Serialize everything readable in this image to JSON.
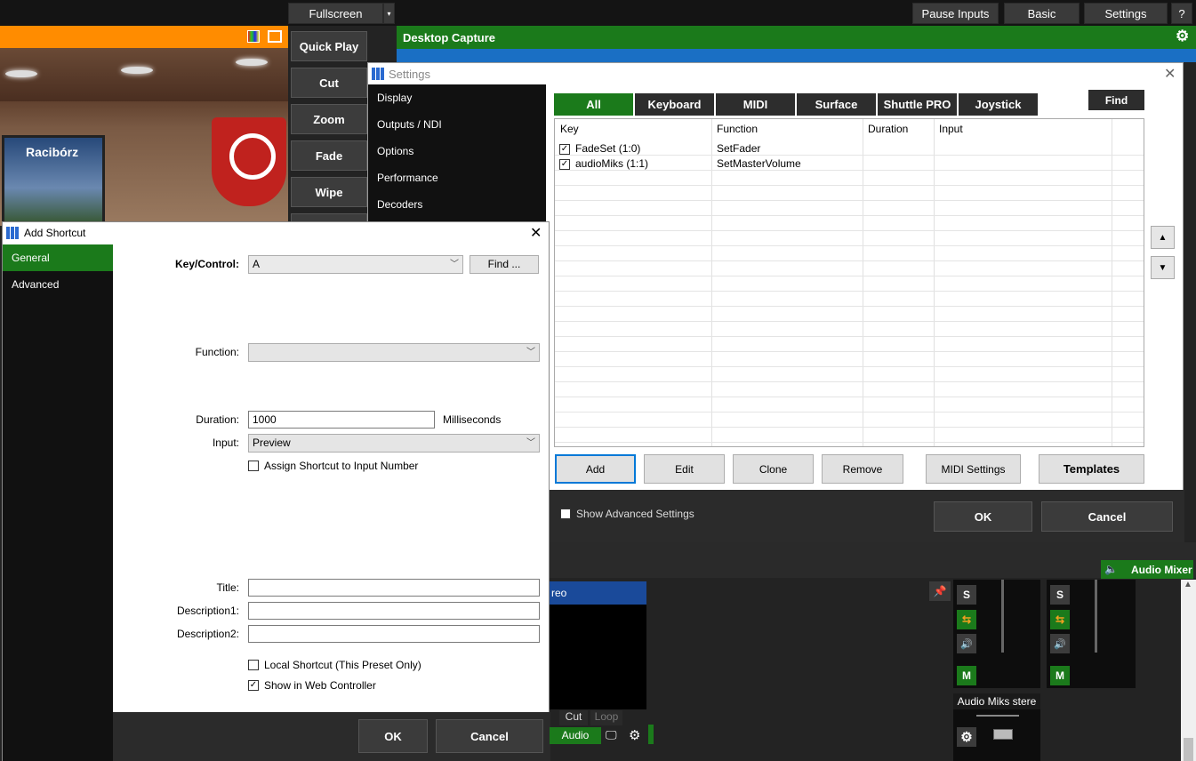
{
  "topbar": {
    "fullscreen": "Fullscreen",
    "pause_inputs": "Pause Inputs",
    "basic": "Basic",
    "settings": "Settings",
    "help": "?"
  },
  "preview": {
    "banner_text": "Racibórz"
  },
  "transitions": {
    "quick_play": "Quick Play",
    "cut": "Cut",
    "zoom": "Zoom",
    "fade": "Fade",
    "wipe": "Wipe"
  },
  "input_panel": {
    "title": "Desktop Capture"
  },
  "settings_dialog": {
    "title": "Settings",
    "nav": [
      "Display",
      "Outputs / NDI",
      "Options",
      "Performance",
      "Decoders"
    ],
    "tabs": [
      "All",
      "Keyboard",
      "MIDI",
      "Surface",
      "Shuttle PRO",
      "Joystick"
    ],
    "find": "Find",
    "columns": [
      "Key",
      "Function",
      "Duration",
      "Input"
    ],
    "rows": [
      {
        "checked": true,
        "key": "FadeSet (1:0)",
        "function": "SetFader",
        "duration": "",
        "input": ""
      },
      {
        "checked": true,
        "key": "audioMiks (1:1)",
        "function": "SetMasterVolume",
        "duration": "",
        "input": ""
      }
    ],
    "buttons": {
      "add": "Add",
      "edit": "Edit",
      "clone": "Clone",
      "remove": "Remove",
      "midi_settings": "MIDI Settings",
      "templates": "Templates"
    },
    "show_advanced": "Show Advanced Settings",
    "ok": "OK",
    "cancel": "Cancel"
  },
  "add_shortcut": {
    "title": "Add Shortcut",
    "nav": [
      "General",
      "Advanced"
    ],
    "key_control_label": "Key/Control:",
    "key_control_value": "A",
    "find_button": "Find ...",
    "function_label": "Function:",
    "function_value": "",
    "duration_label": "Duration:",
    "duration_value": "1000",
    "duration_unit": "Milliseconds",
    "input_label": "Input:",
    "input_value": "Preview",
    "assign_number": "Assign Shortcut to Input Number",
    "title_label": "Title:",
    "desc1_label": "Description1:",
    "desc2_label": "Description2:",
    "local_shortcut": "Local Shortcut (This Preset Only)",
    "show_web": "Show in Web Controller",
    "ok": "OK",
    "cancel": "Cancel"
  },
  "lower": {
    "input_label": "reo",
    "cut": "Cut",
    "loop": "Loop",
    "audio": "Audio"
  },
  "audio_mixer": {
    "title": "Audio Mixer",
    "channel_label": "Audio Miks stere",
    "solo": "S",
    "mute": "M"
  },
  "colors": {
    "accent_green": "#1b7a1b",
    "preview_orange": "#ff8c00",
    "capture_blue": "#1a6fc4"
  }
}
